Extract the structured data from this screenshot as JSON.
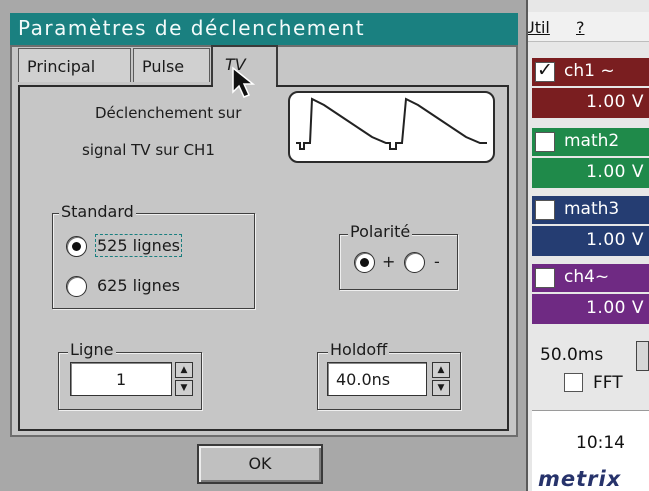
{
  "dialog": {
    "title": "Paramètres de déclenchement",
    "tabs": [
      {
        "label": "Principal",
        "active": false
      },
      {
        "label": "Pulse",
        "active": false
      },
      {
        "label": "TV",
        "active": true
      }
    ],
    "description": {
      "line1": "Déclenchement sur",
      "line2": "signal TV sur CH1"
    },
    "standard": {
      "legend": "Standard",
      "options": [
        {
          "label": "525 lignes",
          "selected": true
        },
        {
          "label": "625 lignes",
          "selected": false
        }
      ]
    },
    "polarity": {
      "legend": "Polarité",
      "options": [
        {
          "label": "+",
          "selected": true
        },
        {
          "label": "-",
          "selected": false
        }
      ]
    },
    "ligne": {
      "legend": "Ligne",
      "value": "1"
    },
    "holdoff": {
      "legend": "Holdoff",
      "value": "40.0ns"
    },
    "ok_label": "OK"
  },
  "app": {
    "menu": [
      "Util",
      "?"
    ],
    "channels": [
      {
        "name": "ch1 ~",
        "value": "1.00 V",
        "checked": true,
        "color": "#7a1e20"
      },
      {
        "name": "math2",
        "value": "1.00 V",
        "checked": false,
        "color": "#1f8a4a"
      },
      {
        "name": "math3",
        "value": "1.00 V",
        "checked": false,
        "color": "#253d72"
      },
      {
        "name": "ch4~",
        "value": "1.00 V",
        "checked": false,
        "color": "#6f2a83"
      }
    ],
    "timebase": "50.0ms",
    "fft_label": "FFT",
    "clock": "10:14",
    "brand": "metrix"
  },
  "colors": {
    "title_bar": "#1a8080",
    "dialog_bg": "#c6c6c6",
    "focus_outline": "#1a7f7f"
  }
}
